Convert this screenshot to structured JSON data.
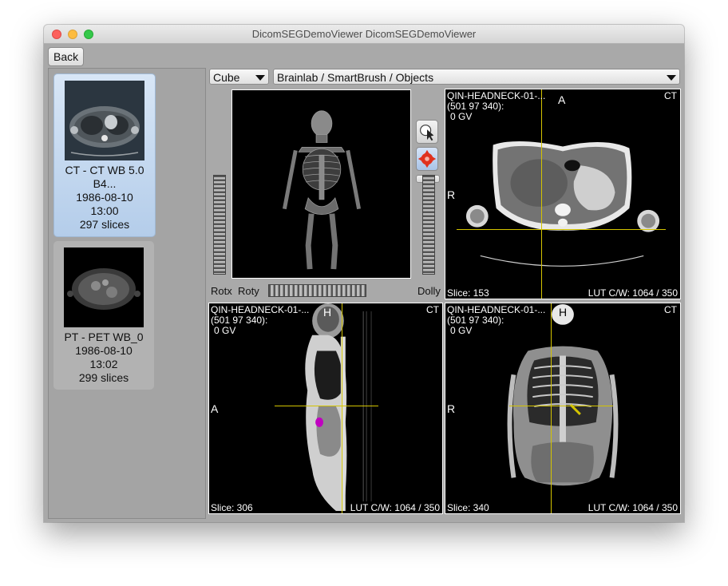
{
  "window": {
    "title": "DicomSEGDemoViewer DicomSEGDemoViewer"
  },
  "toolbar": {
    "back_label": "Back",
    "view_mode": "Cube",
    "segmentation_path": "Brainlab / SmartBrush / Objects"
  },
  "series": [
    {
      "line1": "CT - CT WB 5.0",
      "line2": "B4...",
      "date": "1986-08-10",
      "time": "13:00",
      "count": "297 slices"
    },
    {
      "line1": "PT - PET WB_0",
      "date": "1986-08-10",
      "time": "13:02",
      "count": "299 slices"
    }
  ],
  "render3d": {
    "rotx_label": "Rotx",
    "roty_label": "Roty",
    "dolly_label": "Dolly",
    "collapse_label": "»"
  },
  "views": {
    "axial": {
      "patient": "QIN-HEADNECK-01-...",
      "coords": "(501 97 340):",
      "value": "0 GV",
      "modality": "CT",
      "orient_top": "A",
      "orient_left": "R",
      "slice": "Slice: 153",
      "lut": "LUT C/W: 1064 / 350"
    },
    "sagittal": {
      "patient": "QIN-HEADNECK-01-...",
      "coords": "(501 97 340):",
      "value": "0 GV",
      "modality": "CT",
      "orient_top": "H",
      "orient_left": "A",
      "slice": "Slice: 306",
      "lut": "LUT C/W: 1064 / 350"
    },
    "coronal": {
      "patient": "QIN-HEADNECK-01-...",
      "coords": "(501 97 340):",
      "value": "0 GV",
      "modality": "CT",
      "orient_top": "H",
      "orient_left": "R",
      "slice": "Slice: 340",
      "lut": "LUT C/W: 1064 / 350"
    }
  },
  "colors": {
    "crosshair": "#d4c400",
    "selected_card": "#c6daf1"
  }
}
